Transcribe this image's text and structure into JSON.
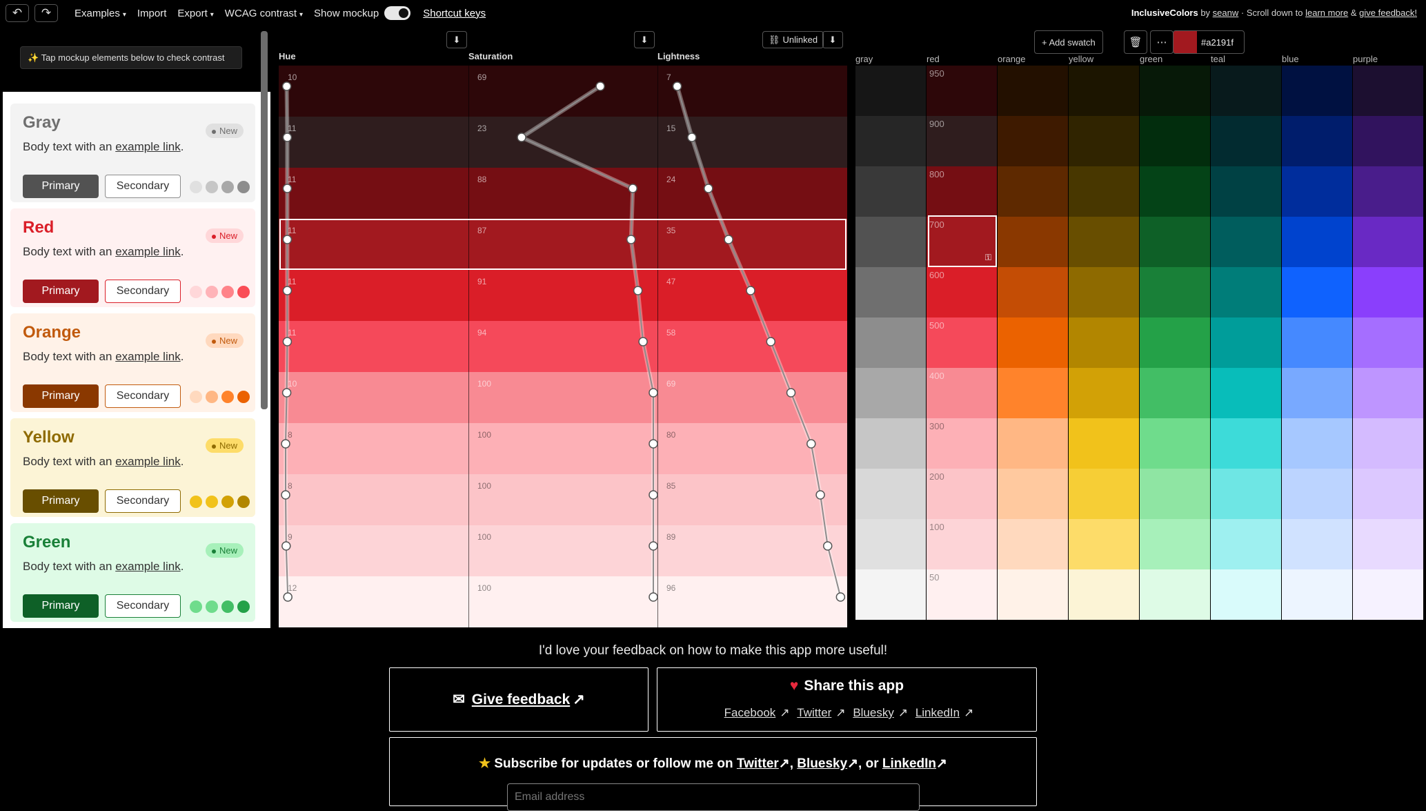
{
  "topbar": {
    "undo_icon": "undo-icon",
    "redo_icon": "redo-icon",
    "menus": [
      "Examples",
      "Import",
      "Export",
      "WCAG contrast"
    ],
    "show_mockup_label": "Show mockup",
    "show_mockup_on": true,
    "shortcut_keys": "Shortcut keys",
    "credit": {
      "app": "InclusiveColors",
      "by": "by",
      "author": "seanw",
      "middle": "· Scroll down to",
      "learn_more": "learn more",
      "amp": "&",
      "give_feedback": "give feedback!"
    }
  },
  "mockup": {
    "hint": "✨ Tap mockup elements below to check contrast",
    "cards": [
      {
        "title": "Gray",
        "badge": "New",
        "body_prefix": "Body text with an",
        "link": "example link",
        "body_suffix": ".",
        "primary": "Primary",
        "secondary": "Secondary",
        "bg": "#f3f3f3",
        "title_color": "#6f6f6f",
        "primary_bg": "#525252",
        "border": "#8d8d8d",
        "badge_bg": "#e0e0e0",
        "badge_dot": "#6f6f6f",
        "dots": [
          "#e0e0e0",
          "#c6c6c6",
          "#a8a8a8",
          "#8d8d8d"
        ]
      },
      {
        "title": "Red",
        "badge": "New",
        "body_prefix": "Body text with an",
        "link": "example link",
        "body_suffix": ".",
        "primary": "Primary",
        "secondary": "Secondary",
        "bg": "#fff1f1",
        "title_color": "#da1e28",
        "primary_bg": "#a2191f",
        "border": "#da1e28",
        "badge_bg": "#ffd7d9",
        "badge_dot": "#da1e28",
        "dots": [
          "#ffd7d9",
          "#ffb3b8",
          "#ff8389",
          "#fa4d56"
        ]
      },
      {
        "title": "Orange",
        "badge": "New",
        "body_prefix": "Body text with an",
        "link": "example link",
        "body_suffix": ".",
        "primary": "Primary",
        "secondary": "Secondary",
        "bg": "#fff2e8",
        "title_color": "#c15a0d",
        "primary_bg": "#8a3800",
        "border": "#c15a0d",
        "badge_bg": "#ffd9be",
        "badge_dot": "#c15a0d",
        "dots": [
          "#ffd9be",
          "#ffb784",
          "#ff832b",
          "#eb6200"
        ]
      },
      {
        "title": "Yellow",
        "badge": "New",
        "body_prefix": "Body text with an",
        "link": "example link",
        "body_suffix": ".",
        "primary": "Primary",
        "secondary": "Secondary",
        "bg": "#fcf4d6",
        "title_color": "#8e6a00",
        "primary_bg": "#684e00",
        "border": "#8e6a00",
        "badge_bg": "#fddc69",
        "badge_dot": "#8e6a00",
        "dots": [
          "#f1c21b",
          "#f1c21b",
          "#d2a106",
          "#b28600"
        ]
      },
      {
        "title": "Green",
        "badge": "New",
        "body_prefix": "Body text with an",
        "link": "example link",
        "body_suffix": ".",
        "primary": "Primary",
        "secondary": "Secondary",
        "bg": "#defbe6",
        "title_color": "#198038",
        "primary_bg": "#0e6027",
        "border": "#198038",
        "badge_bg": "#a7f0ba",
        "badge_dot": "#198038",
        "dots": [
          "#6fdc8c",
          "#6fdc8c",
          "#42be65",
          "#24a148"
        ]
      }
    ]
  },
  "editor": {
    "headers": [
      "Hue",
      "Saturation",
      "Lightness"
    ],
    "unlinked_label": "Unlinked",
    "download_icon": "download-icon",
    "link_icon": "unlink-icon",
    "rows": [
      {
        "hue": 10,
        "sat": 69,
        "light": 7,
        "color": "#2d0709"
      },
      {
        "hue": 11,
        "sat": 23,
        "light": 15,
        "color": "#2f1d1e"
      },
      {
        "hue": 11,
        "sat": 88,
        "light": 24,
        "color": "#750e13"
      },
      {
        "hue": 11,
        "sat": 87,
        "light": 35,
        "color": "#a2191f"
      },
      {
        "hue": 11,
        "sat": 91,
        "light": 47,
        "color": "#da1e28"
      },
      {
        "hue": 11,
        "sat": 94,
        "light": 58,
        "color": "#f5495a"
      },
      {
        "hue": 10,
        "sat": 100,
        "light": 69,
        "color": "#f88a93"
      },
      {
        "hue": 8,
        "sat": 100,
        "light": 80,
        "color": "#fdb0b6"
      },
      {
        "hue": 8,
        "sat": 100,
        "light": 85,
        "color": "#fcc4c8"
      },
      {
        "hue": 9,
        "sat": 100,
        "light": 89,
        "color": "#fdd4d7"
      },
      {
        "hue": 12,
        "sat": 100,
        "light": 96,
        "color": "#fff0f0"
      }
    ],
    "selected_row": 3
  },
  "palette": {
    "add_swatch": "+ Add swatch",
    "trash_icon": "trash-icon",
    "more_icon": "more-icon",
    "selected_hex": "#a2191f",
    "hues": [
      "gray",
      "red",
      "orange",
      "yellow",
      "green",
      "teal",
      "blue",
      "purple"
    ],
    "shades": [
      "950",
      "900",
      "800",
      "700",
      "600",
      "500",
      "400",
      "300",
      "200",
      "100",
      "50"
    ],
    "colors": {
      "gray": [
        "#161616",
        "#262626",
        "#393939",
        "#525252",
        "#6f6f6f",
        "#8d8d8d",
        "#a8a8a8",
        "#c6c6c6",
        "#d8d8d8",
        "#e0e0e0",
        "#f4f4f4"
      ],
      "red": [
        "#2d0709",
        "#2f1d1e",
        "#750e13",
        "#a2191f",
        "#da1e28",
        "#f5495a",
        "#f88a93",
        "#fdb0b6",
        "#fcc4c8",
        "#fdd4d7",
        "#fff0f0"
      ],
      "orange": [
        "#231000",
        "#3e1a00",
        "#5e2900",
        "#8a3800",
        "#c44d05",
        "#eb6200",
        "#ff832b",
        "#ffb784",
        "#ffc99f",
        "#ffd9be",
        "#fff2e8"
      ],
      "yellow": [
        "#1c1500",
        "#302400",
        "#483700",
        "#684e00",
        "#8e6a00",
        "#b28600",
        "#d2a106",
        "#f1c21b",
        "#f6ce36",
        "#fddc69",
        "#fcf4d6"
      ],
      "green": [
        "#071908",
        "#022d0d",
        "#044317",
        "#0e6027",
        "#198038",
        "#24a148",
        "#42be65",
        "#6fdc8c",
        "#8fe5a3",
        "#a7f0ba",
        "#defbe6"
      ],
      "teal": [
        "#081a1c",
        "#022b30",
        "#004144",
        "#005d5d",
        "#007d79",
        "#009d9a",
        "#08bdba",
        "#3ddbd9",
        "#6ee6e4",
        "#9ef0f0",
        "#d9fbfb"
      ],
      "blue": [
        "#001141",
        "#001d6c",
        "#002d9c",
        "#0043ce",
        "#0f62fe",
        "#4589ff",
        "#78a9ff",
        "#a6c8ff",
        "#bcd4ff",
        "#d0e2ff",
        "#edf5ff"
      ],
      "purple": [
        "#1c0f30",
        "#31135e",
        "#491d8b",
        "#6929c4",
        "#8a3ffc",
        "#a56eff",
        "#be95ff",
        "#d4bbff",
        "#dcc8ff",
        "#e8daff",
        "#f6f2ff"
      ]
    },
    "selected": {
      "hue": "red",
      "shade": "700"
    }
  },
  "footer": {
    "feedback_line": "I'd love your feedback on how to make this app more useful!",
    "give_feedback": "Give feedback",
    "share_title": "Share this app",
    "share_links": [
      "Facebook",
      "Twitter",
      "Bluesky",
      "LinkedIn"
    ],
    "subscribe_prefix": "Subscribe for updates or follow me on",
    "subscribe_links": [
      "Twitter",
      "Bluesky",
      "LinkedIn"
    ],
    "email_placeholder": "Email address"
  }
}
